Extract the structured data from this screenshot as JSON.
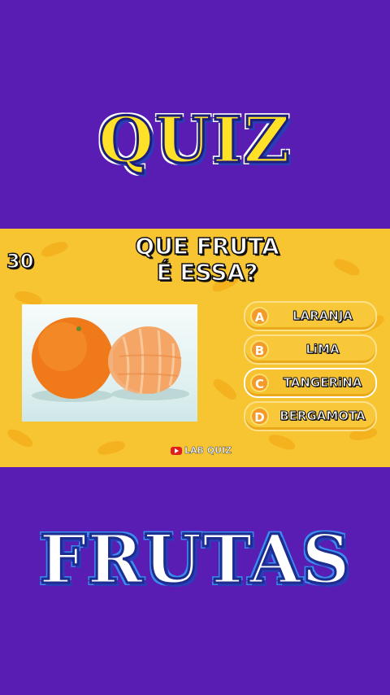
{
  "header": {
    "title": "QUIZ"
  },
  "footer": {
    "title": "FRUTAS"
  },
  "quiz": {
    "timer": "30",
    "question_line1": "QUE FRUTA",
    "question_line2": "É ESSA?",
    "image_icon": "tangerine-photo",
    "answers": [
      {
        "letter": "A",
        "text": "LARANJA"
      },
      {
        "letter": "B",
        "text": "LiMA"
      },
      {
        "letter": "C",
        "text": "TANGERiNA"
      },
      {
        "letter": "D",
        "text": "BERGAMOTA"
      }
    ],
    "brand": "LAB QUIZ"
  },
  "colors": {
    "background": "#5a1db3",
    "card": "#f7c531",
    "quiz_title": "#ffe227",
    "letter_badge": "#f49a2a"
  }
}
